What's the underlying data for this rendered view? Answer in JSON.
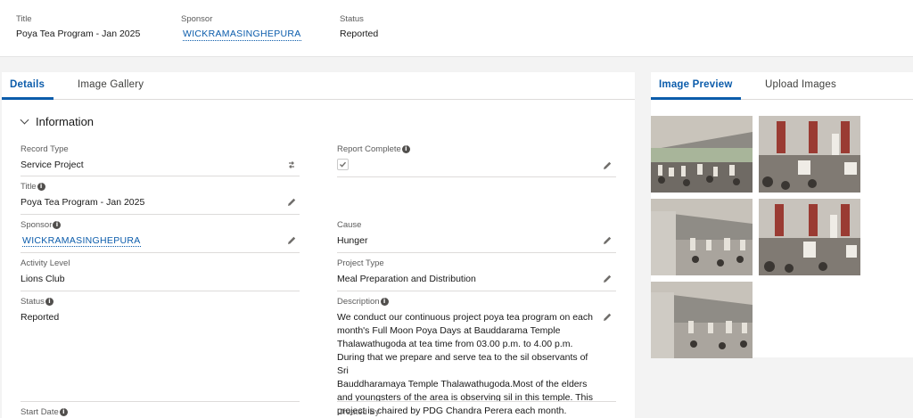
{
  "header": {
    "title_label": "Title",
    "title_value": "Poya Tea Program - Jan 2025",
    "sponsor_label": "Sponsor",
    "sponsor_value": "WICKRAMASINGHEPURA",
    "status_label": "Status",
    "status_value": "Reported"
  },
  "left_tabs": [
    {
      "label": "Details"
    },
    {
      "label": "Image Gallery"
    }
  ],
  "right_tabs": [
    {
      "label": "Image Preview"
    },
    {
      "label": "Upload Images"
    }
  ],
  "section": {
    "title": "Information"
  },
  "fields": {
    "record_type": {
      "label": "Record Type",
      "value": "Service Project"
    },
    "report_complete": {
      "label": "Report Complete",
      "checked": true
    },
    "title": {
      "label": "Title",
      "value": "Poya Tea Program - Jan 2025"
    },
    "sponsor": {
      "label": "Sponsor",
      "value": "WICKRAMASINGHEPURA"
    },
    "cause": {
      "label": "Cause",
      "value": "Hunger"
    },
    "activity_level": {
      "label": "Activity Level",
      "value": "Lions Club"
    },
    "project_type": {
      "label": "Project Type",
      "value": "Meal Preparation and Distribution"
    },
    "status": {
      "label": "Status",
      "value": "Reported"
    },
    "description": {
      "label": "Description",
      "lines": [
        "We conduct our continuous project poya tea program on each",
        "month's Full Moon Poya Days at Bauddarama Temple",
        "Thalawathugoda at tea time from 03.00 p.m. to 4.00 p.m.",
        "During that we prepare and serve tea to the sil observants of Sri",
        "Bauddharamaya Temple Thalawathugoda.Most of the elders",
        "and youngsters of the area is observing sil in this temple. This",
        "project is chaired by PDG Chandra Perera each month."
      ]
    },
    "start_date": {
      "label": "Start Date"
    },
    "created_by": {
      "label": "Created By"
    }
  },
  "icons": {
    "info": "i",
    "edit": "pencil-icon",
    "change_record_type": "switch-icon",
    "expand": "chevron-down-icon"
  },
  "colors": {
    "accent": "#0b5cab",
    "info_icon": "#514f4d"
  },
  "gallery": {
    "image_count": 5
  }
}
